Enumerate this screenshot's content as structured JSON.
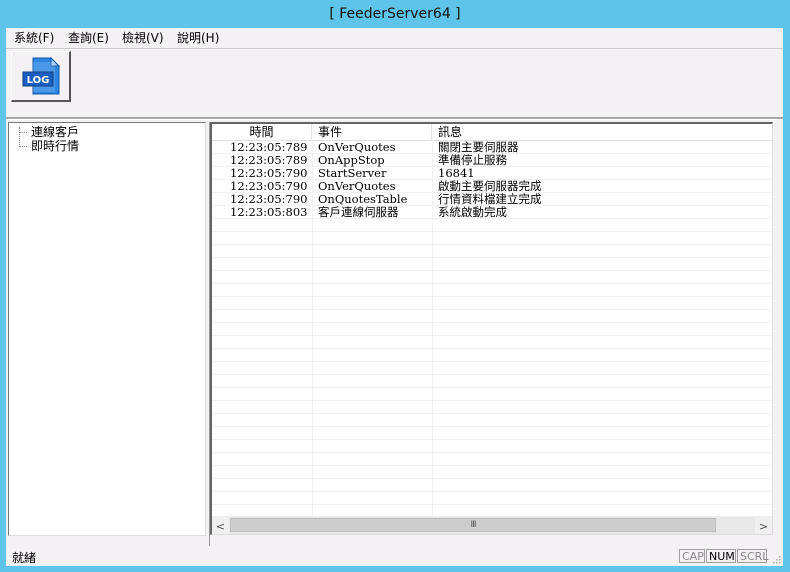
{
  "window": {
    "title": "[ FeederServer64 ]"
  },
  "menu": [
    {
      "label": "系統(F)"
    },
    {
      "label": "查詢(E)"
    },
    {
      "label": "檢視(V)"
    },
    {
      "label": "說明(H)"
    }
  ],
  "toolbar": {
    "log_button_label": "LOG",
    "log_icon": "log-file-icon"
  },
  "tree": {
    "items": [
      {
        "label": "連線客戶"
      },
      {
        "label": "即時行情"
      }
    ]
  },
  "list": {
    "columns": [
      "時間",
      "事件",
      "訊息"
    ],
    "rows": [
      {
        "time": "12:23:05:789",
        "event": "OnVerQuotes",
        "message": "關閉主要伺服器"
      },
      {
        "time": "12:23:05:789",
        "event": "OnAppStop",
        "message": "準備停止服務"
      },
      {
        "time": "12:23:05:790",
        "event": "StartServer",
        "message": "16841"
      },
      {
        "time": "12:23:05:790",
        "event": "OnVerQuotes",
        "message": "啟動主要伺服器完成"
      },
      {
        "time": "12:23:05:790",
        "event": "OnQuotesTable",
        "message": "行情資料檔建立完成"
      },
      {
        "time": "12:23:05:803",
        "event": "客戶連線伺服器",
        "message": "系統啟動完成"
      }
    ],
    "scrollbar": {
      "thumb_grip": "III",
      "left_arrow": "<",
      "right_arrow": ">"
    }
  },
  "status": {
    "text": "就緒",
    "indicators": [
      {
        "label": "CAP",
        "active": false
      },
      {
        "label": "NUM",
        "active": true
      },
      {
        "label": "SCRL",
        "active": false
      }
    ]
  },
  "colors": {
    "title_bar": "#5fc4ea",
    "client_bg": "#f4f1f4",
    "log_icon_blue": "#1a73d6"
  }
}
